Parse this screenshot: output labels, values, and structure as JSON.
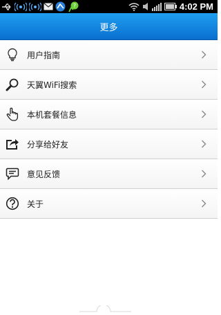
{
  "status_bar": {
    "time": "4:02 PM",
    "icons": [
      "usb-icon",
      "wifi-signal-icon",
      "wifi-signal-icon",
      "email-icon",
      "app-icon",
      "app-icon",
      "wifi-icon",
      "mute-icon",
      "signal-icon",
      "battery-icon"
    ]
  },
  "header": {
    "title": "更多"
  },
  "menu": {
    "items": [
      {
        "label": "用户指南",
        "icon": "lightbulb-icon"
      },
      {
        "label": "天翼WiFi搜索",
        "icon": "search-icon"
      },
      {
        "label": "本机套餐信息",
        "icon": "hand-pointer-icon"
      },
      {
        "label": "分享给好友",
        "icon": "share-icon"
      },
      {
        "label": "意见反馈",
        "icon": "feedback-icon"
      },
      {
        "label": "关于",
        "icon": "help-icon"
      }
    ]
  },
  "colors": {
    "header_top": "#1f9ff0",
    "header_bottom": "#0a6fd0",
    "status_bar": "#000000"
  }
}
